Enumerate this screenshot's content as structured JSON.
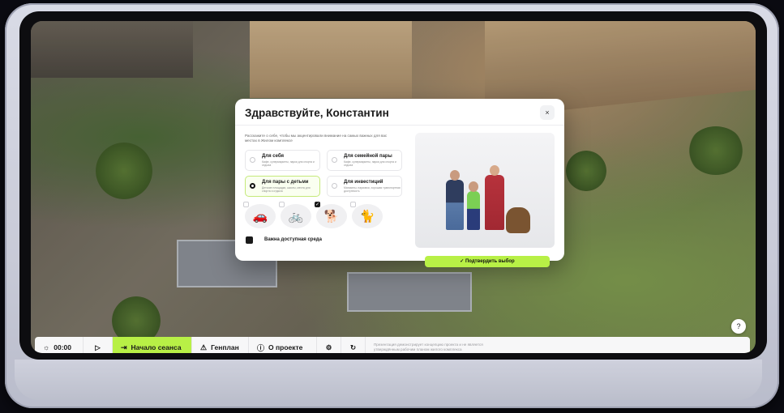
{
  "modal": {
    "title": "Здравствуйте, Константин",
    "close": "×",
    "subtitle": "Расскажите о себе, чтобы мы акцентировали внимание на самых важных для вас местах в Жилом комплексе",
    "options": [
      {
        "title": "Для себя",
        "desc": "Кафе, супермаркеты, парки для спорта и отдыха",
        "active": false
      },
      {
        "title": "Для семейной пары",
        "desc": "Кафе, супермаркеты, парки для спорта и отдыха",
        "active": false
      },
      {
        "title": "Для пары с детьми",
        "desc": "Детские площадки, школы, места для спорта и отдыха",
        "active": true
      },
      {
        "title": "Для инвестиций",
        "desc": "Магазины, парковки, хорошая транспортная доступность",
        "active": false
      }
    ],
    "pets": [
      {
        "icon": "car-icon",
        "checked": false
      },
      {
        "icon": "bicycle-icon",
        "checked": false
      },
      {
        "icon": "dog-icon",
        "checked": true
      },
      {
        "icon": "cat-icon",
        "checked": false
      }
    ],
    "accessibility_label": "Важна доступная среда",
    "confirm_label": "Подтвердить выбор"
  },
  "bottombar": {
    "time": "00:00",
    "session_label": "Начало сеанса",
    "plan_label": "Генплан",
    "about_label": "О проекте",
    "disclaimer": "Презентация демонстрирует концепцию проекта и не является утверждённым рабочим планом жилого комплекса"
  },
  "help": "?",
  "colors": {
    "accent": "#b8f046"
  }
}
